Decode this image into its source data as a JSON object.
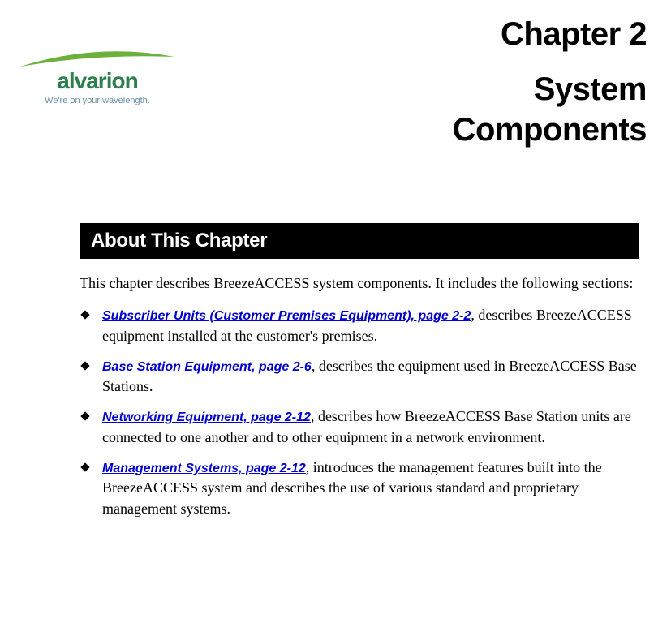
{
  "logo": {
    "brand": "alvarion",
    "tagline": "We're on your wavelength.",
    "swoosh_color": "#6bb03a",
    "brand_color": "#2d7f4e",
    "tagline_color": "#6a8fa8"
  },
  "chapter": {
    "label": "Chapter 2",
    "title_line1": "System",
    "title_line2": "Components"
  },
  "section": {
    "bar_title": "About This Chapter",
    "intro": "This chapter describes BreezeACCESS system components. It includes the following sections:"
  },
  "bullets": [
    {
      "link_text": "Subscriber Units (Customer Premises Equipment), page 2-2",
      "trail": ", describes BreezeACCESS equipment installed at the customer's premises."
    },
    {
      "link_text": "Base Station Equipment, page 2-6",
      "trail": ", describes the equipment used in BreezeACCESS Base Stations."
    },
    {
      "link_text": "Networking Equipment, page 2-12",
      "trail": ", describes how BreezeACCESS Base Station units are connected to one another and to other equipment in a network environment."
    },
    {
      "link_text": "Management Systems, page 2-12",
      "trail": ", introduces the management features built into the BreezeACCESS system and describes the use of various standard and proprietary management systems."
    }
  ],
  "colors": {
    "link": "#0000cc",
    "bar_bg": "#000000",
    "bar_fg": "#ffffff"
  }
}
